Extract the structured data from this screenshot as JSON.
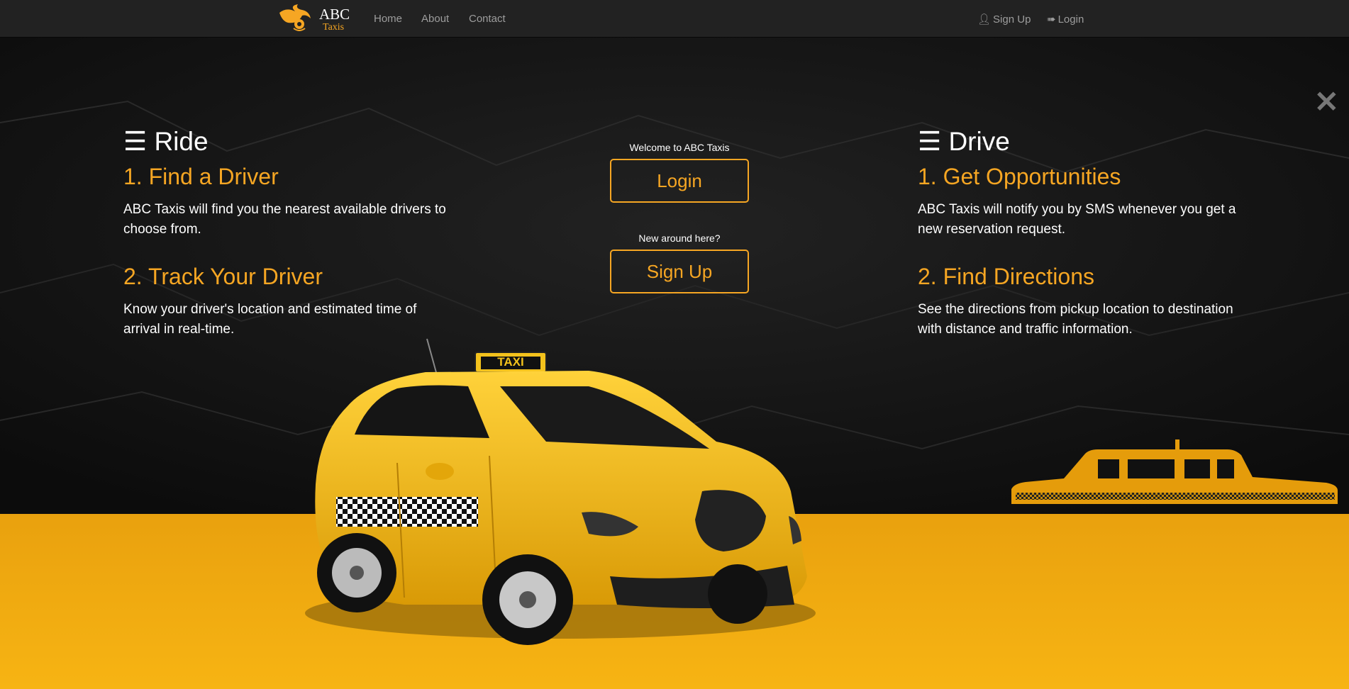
{
  "brand": {
    "name": "ABC",
    "sub": "Taxis"
  },
  "nav": {
    "home": "Home",
    "about": "About",
    "contact": "Contact",
    "signup": "Sign Up",
    "login": "Login"
  },
  "ride": {
    "heading": "Ride",
    "step1_title": "1. Find a Driver",
    "step1_text": "ABC Taxis will find you the nearest available drivers to choose from.",
    "step2_title": "2. Track Your Driver",
    "step2_text": "Know your driver's location and estimated time of arrival in real-time."
  },
  "drive": {
    "heading": "Drive",
    "step1_title": "1. Get Opportunities",
    "step1_text": "ABC Taxis will notify you by SMS whenever you get a new reservation request.",
    "step2_title": "2. Find Directions",
    "step2_text": "See the directions from pickup location to destination with distance and traffic information."
  },
  "center": {
    "welcome": "Welcome to ABC Taxis",
    "login_button": "Login",
    "new_text": "New around here?",
    "signup_button": "Sign Up"
  },
  "taxi_sign": "TAXI",
  "colors": {
    "accent": "#f6a623",
    "navbar": "#222222",
    "ground": "#f3ac11",
    "wall": "#141414"
  },
  "icons": {
    "menu": "hamburger-menu-icon",
    "close": "close-icon",
    "user": "user-icon",
    "login": "sign-in-icon"
  }
}
